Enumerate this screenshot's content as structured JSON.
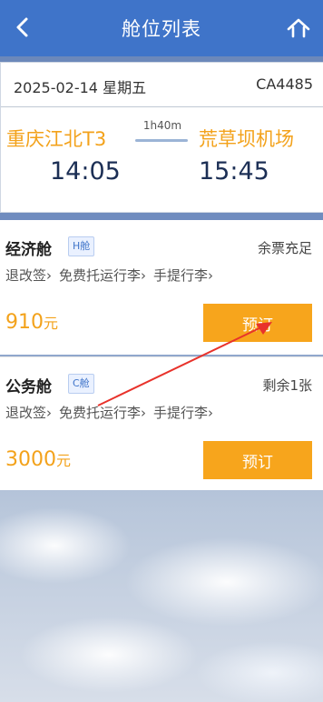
{
  "nav": {
    "title": "舱位列表"
  },
  "flight": {
    "date": "2025-02-14 星期五",
    "flight_no": "CA4485",
    "dep_airport": "重庆江北T3",
    "arr_airport": "荒草坝机场",
    "duration": "1h40m",
    "dep_time": "14:05",
    "arr_time": "15:45"
  },
  "cabins": [
    {
      "name": "经济舱",
      "class_badge": "H舱",
      "seats": "余票充足",
      "rules": [
        "退改签",
        "免费托运行李",
        "手提行李"
      ],
      "price": "910",
      "currency": "元",
      "button": "预订"
    },
    {
      "name": "公务舱",
      "class_badge": "C舱",
      "seats": "剩余1张",
      "rules": [
        "退改签",
        "免费托运行李",
        "手提行李"
      ],
      "price": "3000",
      "currency": "元",
      "button": "预订"
    }
  ],
  "icons": {
    "back": "chevron-left-icon",
    "home": "home-icon"
  },
  "colors": {
    "header": "#3f74c9",
    "accent": "#f7a51c",
    "badge": "#3f74c9"
  }
}
